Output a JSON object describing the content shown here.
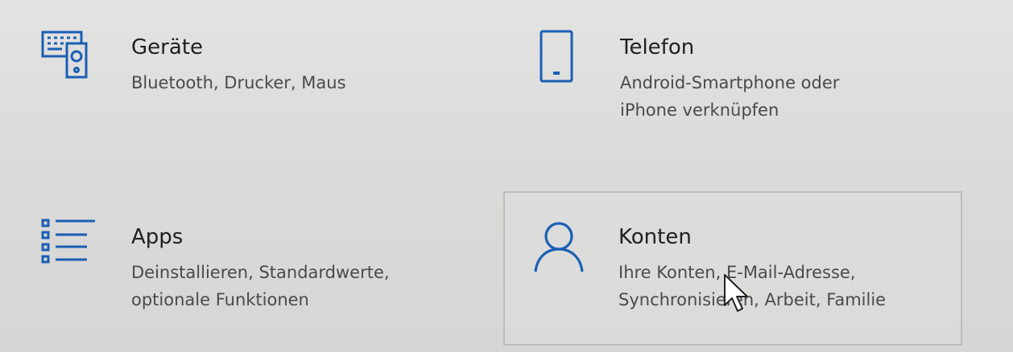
{
  "accent_color": "#1a5fb4",
  "tiles": [
    {
      "icon": "devices-icon",
      "title": "Geräte",
      "description": "Bluetooth, Drucker, Maus"
    },
    {
      "icon": "phone-icon",
      "title": "Telefon",
      "description": "Android-Smartphone oder iPhone verknüpfen"
    },
    {
      "icon": "apps-icon",
      "title": "Apps",
      "description": "Deinstallieren, Standardwerte, optionale Funktionen"
    },
    {
      "icon": "accounts-icon",
      "title": "Konten",
      "description": "Ihre Konten, E-Mail-Adresse, Synchronisieren, Arbeit, Familie"
    }
  ]
}
